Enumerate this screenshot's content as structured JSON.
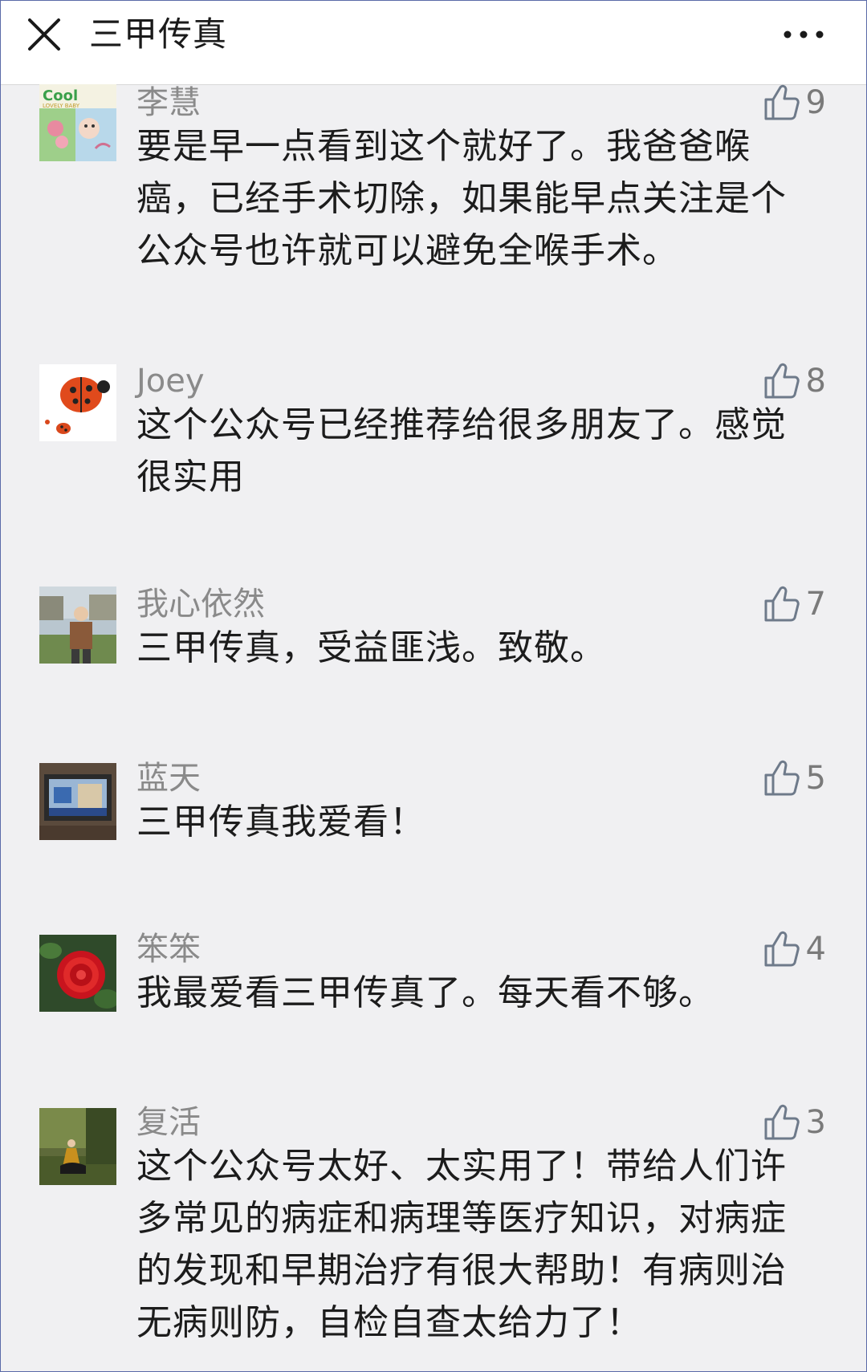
{
  "header": {
    "title": "三甲传真"
  },
  "comments": [
    {
      "name": "李慧",
      "likes": "9",
      "text": "要是早一点看到这个就好了。我爸爸喉癌，已经手术切除，如果能早点关注是个公众号也许就可以避免全喉手术。"
    },
    {
      "name": "Joey",
      "likes": "8",
      "text": "这个公众号已经推荐给很多朋友了。感觉很实用"
    },
    {
      "name": "我心依然",
      "likes": "7",
      "text": "三甲传真，受益匪浅。致敬。"
    },
    {
      "name": "蓝天",
      "likes": "5",
      "text": "三甲传真我爱看！"
    },
    {
      "name": "笨笨",
      "likes": "4",
      "text": "我最爱看三甲传真了。每天看不够。"
    },
    {
      "name": "复活",
      "likes": "3",
      "text": "这个公众号太好、太实用了！带给人们许多常见的病症和病理等医疗知识，对病症的发现和早期治疗有很大帮助！有病则治无病则防，自检自查太给力了！"
    }
  ],
  "colors": {
    "header_bg": "#ffffff",
    "page_bg": "#f0f0f2",
    "name_text": "#8a8a8a",
    "body_text": "#1c1c1c",
    "like_icon": "#6e7a8a"
  },
  "icons": {
    "close": "close-icon",
    "more": "more-icon",
    "like": "thumbs-up-icon"
  }
}
